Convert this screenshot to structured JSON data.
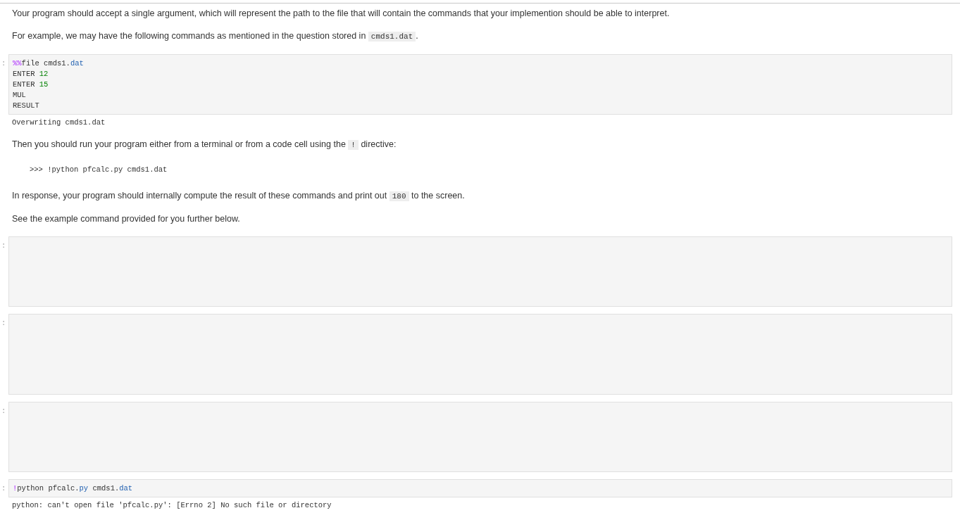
{
  "cells": [
    {
      "kind": "markdown",
      "blocks": [
        {
          "kind": "paragraph",
          "parts": [
            {
              "kind": "text",
              "text": "Your program should accept a single argument, which will represent the path to the file that will contain the commands that your implemention should be able to interpret."
            }
          ]
        },
        {
          "kind": "paragraph",
          "parts": [
            {
              "kind": "text",
              "text": "For example, we may have the following commands as mentioned in the question stored in "
            },
            {
              "kind": "code",
              "text": "cmds1.dat"
            },
            {
              "kind": "text",
              "text": "."
            }
          ]
        }
      ]
    },
    {
      "kind": "code",
      "prompt": ":",
      "lines": [
        [
          {
            "kind": "magic",
            "text": "%%"
          },
          {
            "kind": "plain",
            "text": "file cmds1."
          },
          {
            "kind": "attr",
            "text": "dat"
          }
        ],
        [
          {
            "kind": "plain",
            "text": "ENTER "
          },
          {
            "kind": "number",
            "text": "12"
          }
        ],
        [
          {
            "kind": "plain",
            "text": "ENTER "
          },
          {
            "kind": "number",
            "text": "15"
          }
        ],
        [
          {
            "kind": "plain",
            "text": "MUL"
          }
        ],
        [
          {
            "kind": "plain",
            "text": "RESULT"
          }
        ]
      ]
    },
    {
      "kind": "output",
      "lines": [
        "Overwriting cmds1.dat"
      ]
    },
    {
      "kind": "markdown",
      "blocks": [
        {
          "kind": "paragraph",
          "parts": [
            {
              "kind": "text",
              "text": "Then you should run your program either from a terminal or from a code cell using the "
            },
            {
              "kind": "code",
              "text": "!"
            },
            {
              "kind": "text",
              "text": " directive:"
            }
          ]
        },
        {
          "kind": "code_block",
          "text": ">>> !python pfcalc.py cmds1.dat"
        },
        {
          "kind": "paragraph",
          "parts": [
            {
              "kind": "text",
              "text": "In response, your program should internally compute the result of these commands and print out "
            },
            {
              "kind": "code",
              "text": "180"
            },
            {
              "kind": "text",
              "text": " to the screen."
            }
          ]
        },
        {
          "kind": "paragraph",
          "parts": [
            {
              "kind": "text",
              "text": "See the example command provided for you further below."
            }
          ]
        }
      ]
    },
    {
      "kind": "code",
      "prompt": ":"
    },
    {
      "kind": "code",
      "prompt": ":"
    },
    {
      "kind": "code",
      "prompt": ":"
    },
    {
      "kind": "code",
      "prompt": ":",
      "lines": [
        [
          {
            "kind": "magic",
            "text": "!"
          },
          {
            "kind": "plain",
            "text": "python pfcalc."
          },
          {
            "kind": "attr",
            "text": "py"
          },
          {
            "kind": "plain",
            "text": " cmds1."
          },
          {
            "kind": "attr",
            "text": "dat"
          }
        ]
      ]
    },
    {
      "kind": "output",
      "lines": [
        "python: can't open file 'pfcalc.py': [Errno 2] No such file or directory"
      ]
    }
  ]
}
